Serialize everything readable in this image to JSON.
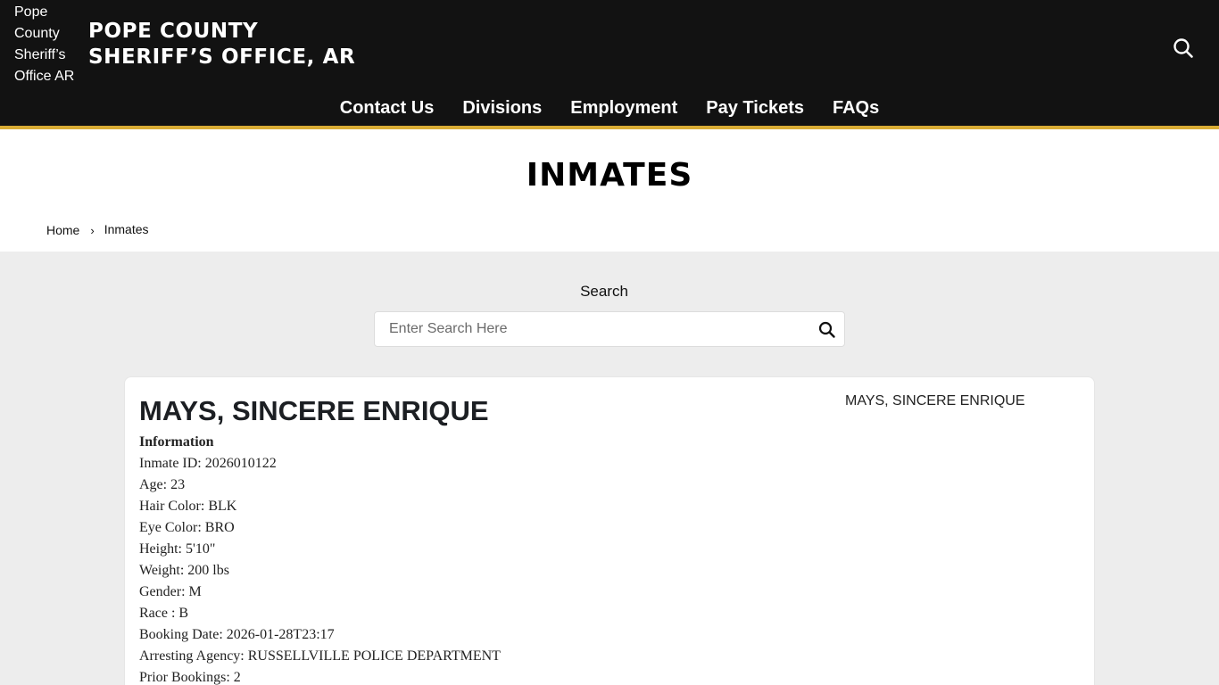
{
  "header": {
    "logo_alt": "Pope County Sheriff’s Office AR",
    "site_title_line1": "POPE COUNTY",
    "site_title_line2": "SHERIFF’S OFFICE, AR",
    "search_icon": "search-icon",
    "nav": [
      {
        "label": "Contact Us"
      },
      {
        "label": "Divisions"
      },
      {
        "label": "Employment"
      },
      {
        "label": "Pay Tickets"
      },
      {
        "label": "FAQs"
      }
    ],
    "accent_color": "#d9ac34",
    "background_color": "#121212"
  },
  "page": {
    "title": "INMATES",
    "breadcrumb": {
      "home": "Home",
      "separator": "›",
      "current": "Inmates"
    }
  },
  "search": {
    "label": "Search",
    "placeholder": "Enter Search Here",
    "value": "",
    "button_icon": "search-icon"
  },
  "inmate": {
    "name": "MAYS, SINCERE ENRIQUE",
    "photo_alt": "MAYS, SINCERE ENRIQUE",
    "info_heading": "Information",
    "fields": [
      {
        "text": "Inmate ID: 2026010122"
      },
      {
        "text": "Age: 23"
      },
      {
        "text": "Hair Color: BLK"
      },
      {
        "text": "Eye Color: BRO"
      },
      {
        "text": "Height: 5'10\""
      },
      {
        "text": "Weight: 200 lbs"
      },
      {
        "text": "Gender: M"
      },
      {
        "text": "Race : B"
      },
      {
        "text": "Booking Date: 2026-01-28T23:17"
      },
      {
        "text": "Arresting Agency: RUSSELLVILLE POLICE DEPARTMENT"
      },
      {
        "text": "Prior Bookings: 2"
      }
    ]
  }
}
